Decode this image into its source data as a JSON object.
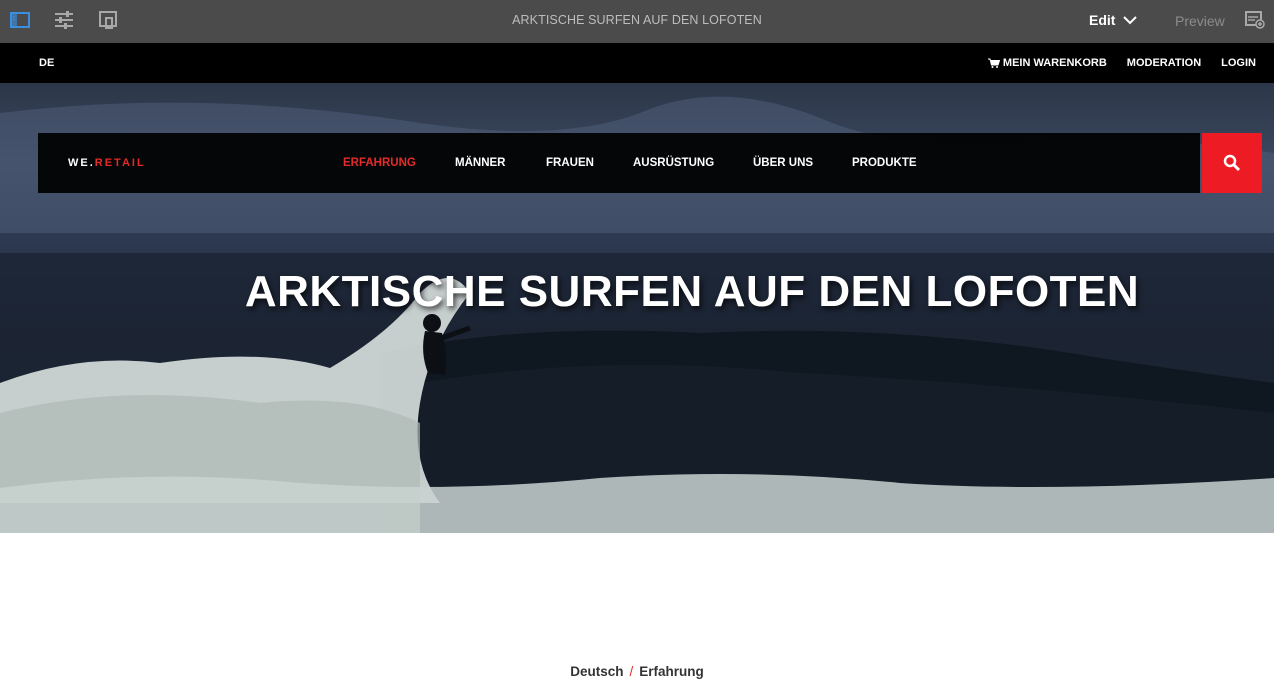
{
  "editor": {
    "title": "ARKTISCHE SURFEN AUF DEN LOFOTEN",
    "mode_label": "Edit",
    "preview_label": "Preview",
    "icons": [
      "side-panel-icon",
      "properties-icon",
      "page-layout-icon",
      "emulator-icon"
    ]
  },
  "topbar": {
    "language": "DE",
    "cart_label": "MEIN WARENKORB",
    "moderation_label": "MODERATION",
    "login_label": "LOGIN"
  },
  "brand": {
    "prefix": "WE.",
    "suffix": "RETAIL"
  },
  "nav": {
    "items": [
      "ERFAHRUNG",
      "MÄNNER",
      "FRAUEN",
      "AUSRÜSTUNG",
      "ÜBER UNS",
      "PRODUKTE"
    ],
    "active": "ERFAHRUNG"
  },
  "hero": {
    "title": "ARKTISCHE SURFEN AUF DEN LOFOTEN"
  },
  "breadcrumb": {
    "items": [
      "Deutsch",
      "Erfahrung"
    ],
    "separator": "/"
  },
  "colors": {
    "accent": "#e32c28",
    "search_bg": "#ed1c24",
    "editor_bg": "#4b4b4b"
  }
}
